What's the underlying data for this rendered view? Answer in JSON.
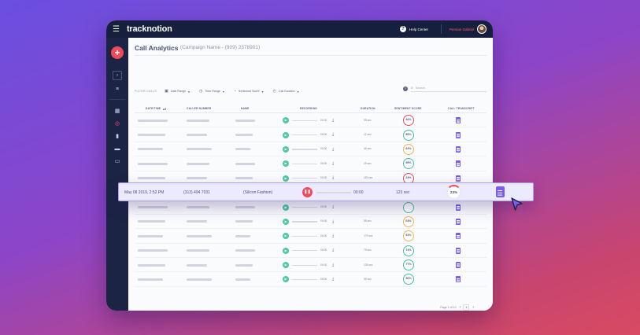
{
  "app": {
    "brand": "tracknotion",
    "help_label": "Help Center",
    "user_name": "Persian Gabriel"
  },
  "page": {
    "title": "Call Analytics",
    "subtitle": "(Campaign Name - (909) 2378901)"
  },
  "filters": {
    "label": "FILTER CALLS",
    "items": [
      {
        "label": "Date Range",
        "icon": "calendar-icon"
      },
      {
        "label": "Time Range",
        "icon": "clock-icon"
      },
      {
        "label": "Sentiment Score",
        "icon": "gauge-icon"
      },
      {
        "label": "Call Duration",
        "icon": "timer-icon"
      }
    ],
    "search_placeholder": "Search"
  },
  "table": {
    "columns": [
      "DATE/TIME",
      "CALLER NUMBER",
      "NAME",
      "RECORDING",
      "DURATION",
      "SENTIMENT SCORE",
      "CALL TRANSCRIPT"
    ],
    "rows": [
      {
        "rec": "00:00",
        "dur": "95 sec",
        "score": "46%",
        "color": "#ef4a5a"
      },
      {
        "rec": "00:00",
        "dur": "12 sec",
        "score": "85%",
        "color": "#3fc49a"
      },
      {
        "rec": "00:00",
        "dur": "45 sec",
        "score": "63%",
        "color": "#f2b34a"
      },
      {
        "rec": "00:00",
        "dur": "29 sec",
        "score": "95%",
        "color": "#3fc49a"
      },
      {
        "rec": "00:00",
        "dur": "115 sec",
        "score": "23%",
        "color": "#ef4a5a"
      },
      {
        "rec": "00:00",
        "dur": "11 sec",
        "score": "94%",
        "color": "#3fc49a"
      },
      {
        "rec": "00:00",
        "dur": "",
        "score": "",
        "color": "#3fc49a"
      },
      {
        "rec": "00:00",
        "dur": "88 sec",
        "score": "63%",
        "color": "#f2b34a"
      },
      {
        "rec": "00:00",
        "dur": "179 sec",
        "score": "63%",
        "color": "#f2b34a"
      },
      {
        "rec": "00:00",
        "dur": "75 sec",
        "score": "74%",
        "color": "#3fc49a"
      },
      {
        "rec": "00:00",
        "dur": "125 sec",
        "score": "77%",
        "color": "#3fc49a"
      },
      {
        "rec": "00:00",
        "dur": "95 sec",
        "score": "90%",
        "color": "#3fc49a"
      }
    ]
  },
  "highlight": {
    "datetime": "May 08 2019, 2:52 PM",
    "caller": "(313) 494 7031",
    "name": "(Silicon Fashion)",
    "rec_time": "00:00",
    "duration": "123 sec",
    "score": "23%"
  },
  "pager": {
    "label": "Page 1 of 10",
    "current": "1"
  }
}
